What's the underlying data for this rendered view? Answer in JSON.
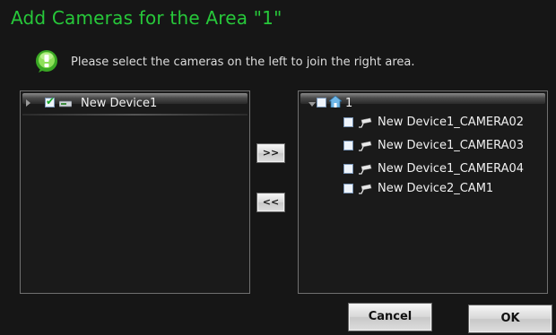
{
  "dialog": {
    "title": "Add Cameras for the Area \"1\"",
    "info_text": "Please select the cameras on the left to join the right area."
  },
  "left_tree": {
    "items": [
      {
        "label": "New Device1",
        "checked": true,
        "icon": "device-icon",
        "expanded": false
      }
    ]
  },
  "right_tree": {
    "root": {
      "label": "1",
      "checked": false,
      "icon": "home-icon",
      "expanded": true
    },
    "items": [
      {
        "label": "New Device1_CAMERA02",
        "checked": false,
        "icon": "camera-icon"
      },
      {
        "label": "New Device1_CAMERA03",
        "checked": false,
        "icon": "camera-icon"
      },
      {
        "label": "New Device1_CAMERA04",
        "checked": false,
        "icon": "camera-icon"
      },
      {
        "label": "New Device2_CAM1",
        "checked": false,
        "icon": "camera-icon"
      }
    ]
  },
  "buttons": {
    "add_label": ">>",
    "remove_label": "<<",
    "cancel_label": "Cancel",
    "ok_label": "OK"
  },
  "colors": {
    "title": "#27c83a",
    "background": "#161616",
    "panel_border": "#707070"
  }
}
